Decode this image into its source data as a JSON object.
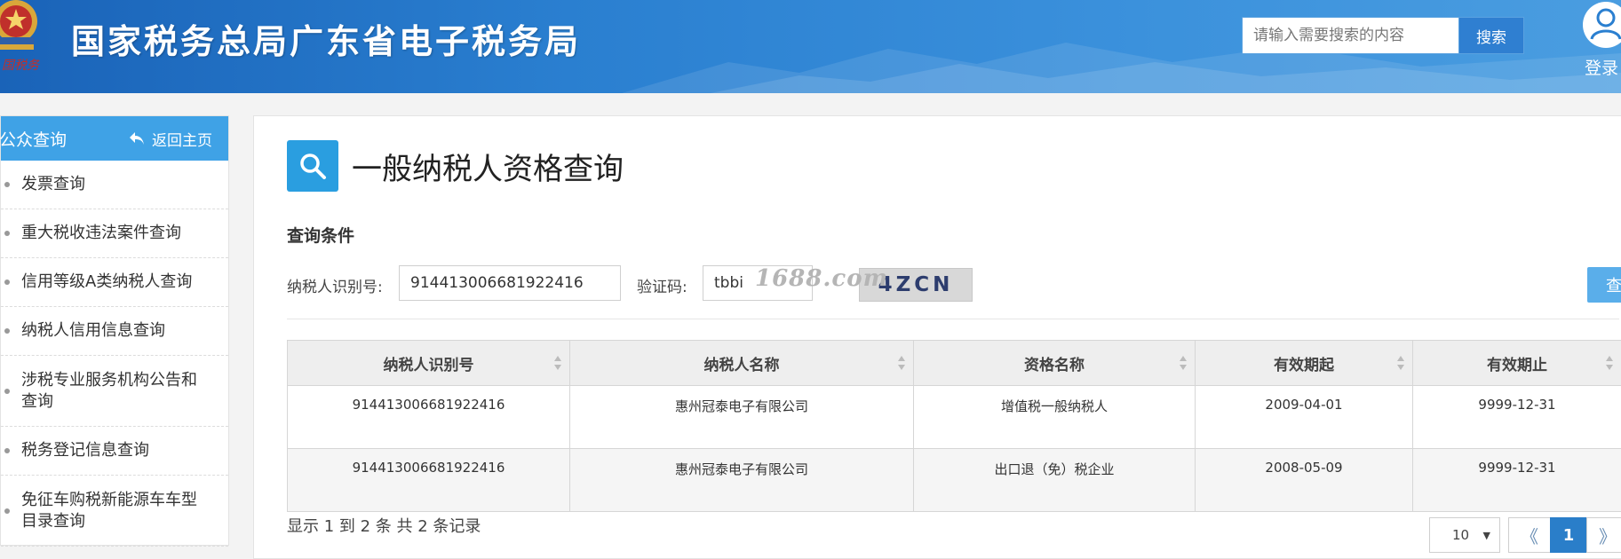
{
  "header": {
    "site_title": "国家税务总局广东省电子税务局",
    "search_placeholder": "请输入需要搜索的内容",
    "search_button": "搜索",
    "login_label": "登录",
    "emblem_text": "国税务"
  },
  "sidebar": {
    "title": "公众查询",
    "back_home": "返回主页",
    "items": [
      {
        "label": "发票查询"
      },
      {
        "label": "重大税收违法案件查询"
      },
      {
        "label": "信用等级A类纳税人查询"
      },
      {
        "label": "纳税人信用信息查询"
      },
      {
        "label": "涉税专业服务机构公告和查询"
      },
      {
        "label": "税务登记信息查询"
      },
      {
        "label": "免征车购税新能源车车型目录查询"
      }
    ]
  },
  "main": {
    "page_title": "一般纳税人资格查询",
    "section_label": "查询条件",
    "form": {
      "taxpayer_id_label": "纳税人识别号:",
      "taxpayer_id_value": "914413006681922416",
      "captcha_label": "验证码:",
      "captcha_value": "tbbi",
      "captcha_image_text": "4ZCN",
      "query_button": "查询"
    },
    "watermark": "1688.com",
    "table": {
      "columns": [
        "纳税人识别号",
        "纳税人名称",
        "资格名称",
        "有效期起",
        "有效期止"
      ],
      "rows": [
        [
          "914413006681922416",
          "惠州冠泰电子有限公司",
          "增值税一般纳税人",
          "2009-04-01",
          "9999-12-31"
        ],
        [
          "914413006681922416",
          "惠州冠泰电子有限公司",
          "出口退（免）税企业",
          "2008-05-09",
          "9999-12-31"
        ]
      ]
    },
    "pagination": {
      "record_info": "显示 1 到 2 条 共 2 条记录",
      "page_size": "10",
      "prev": "《",
      "current_page": "1",
      "next": "》"
    }
  },
  "colors": {
    "header_blue": "#2a7fd0",
    "sidebar_header": "#3fa2e6",
    "query_button": "#5aaeea",
    "page_icon": "#2a9ee0",
    "active_page": "#2a7ec9"
  }
}
